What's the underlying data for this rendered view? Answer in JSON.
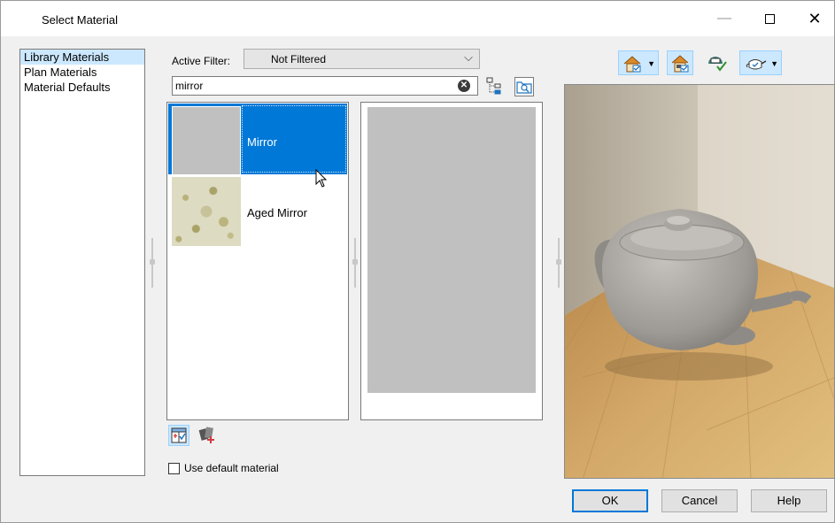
{
  "window": {
    "title": "Select Material",
    "minimize_glyph": "—",
    "close_glyph": "✕"
  },
  "sidebar": {
    "items": [
      {
        "label": "Library Materials",
        "selected": true
      },
      {
        "label": "Plan Materials",
        "selected": false
      },
      {
        "label": "Material Defaults",
        "selected": false
      }
    ]
  },
  "filter": {
    "label": "Active Filter:",
    "value": "Not Filtered",
    "chevron": "⌵"
  },
  "search": {
    "value": "mirror",
    "clear_glyph": "✕"
  },
  "materials": [
    {
      "name": "Mirror",
      "selected": true,
      "swatch_color": "#c0c0c0"
    },
    {
      "name": "Aged Mirror",
      "selected": false,
      "swatch_color": "#dedbc3"
    }
  ],
  "options": {
    "use_default_label": "Use default material",
    "use_default_checked": false
  },
  "colors": {
    "accent": "#0078d7",
    "selection_light": "#cce8ff",
    "floor": "#c8a26a",
    "wall": "#d6cfc2"
  },
  "buttons": {
    "ok": "OK",
    "cancel": "Cancel",
    "help": "Help"
  }
}
